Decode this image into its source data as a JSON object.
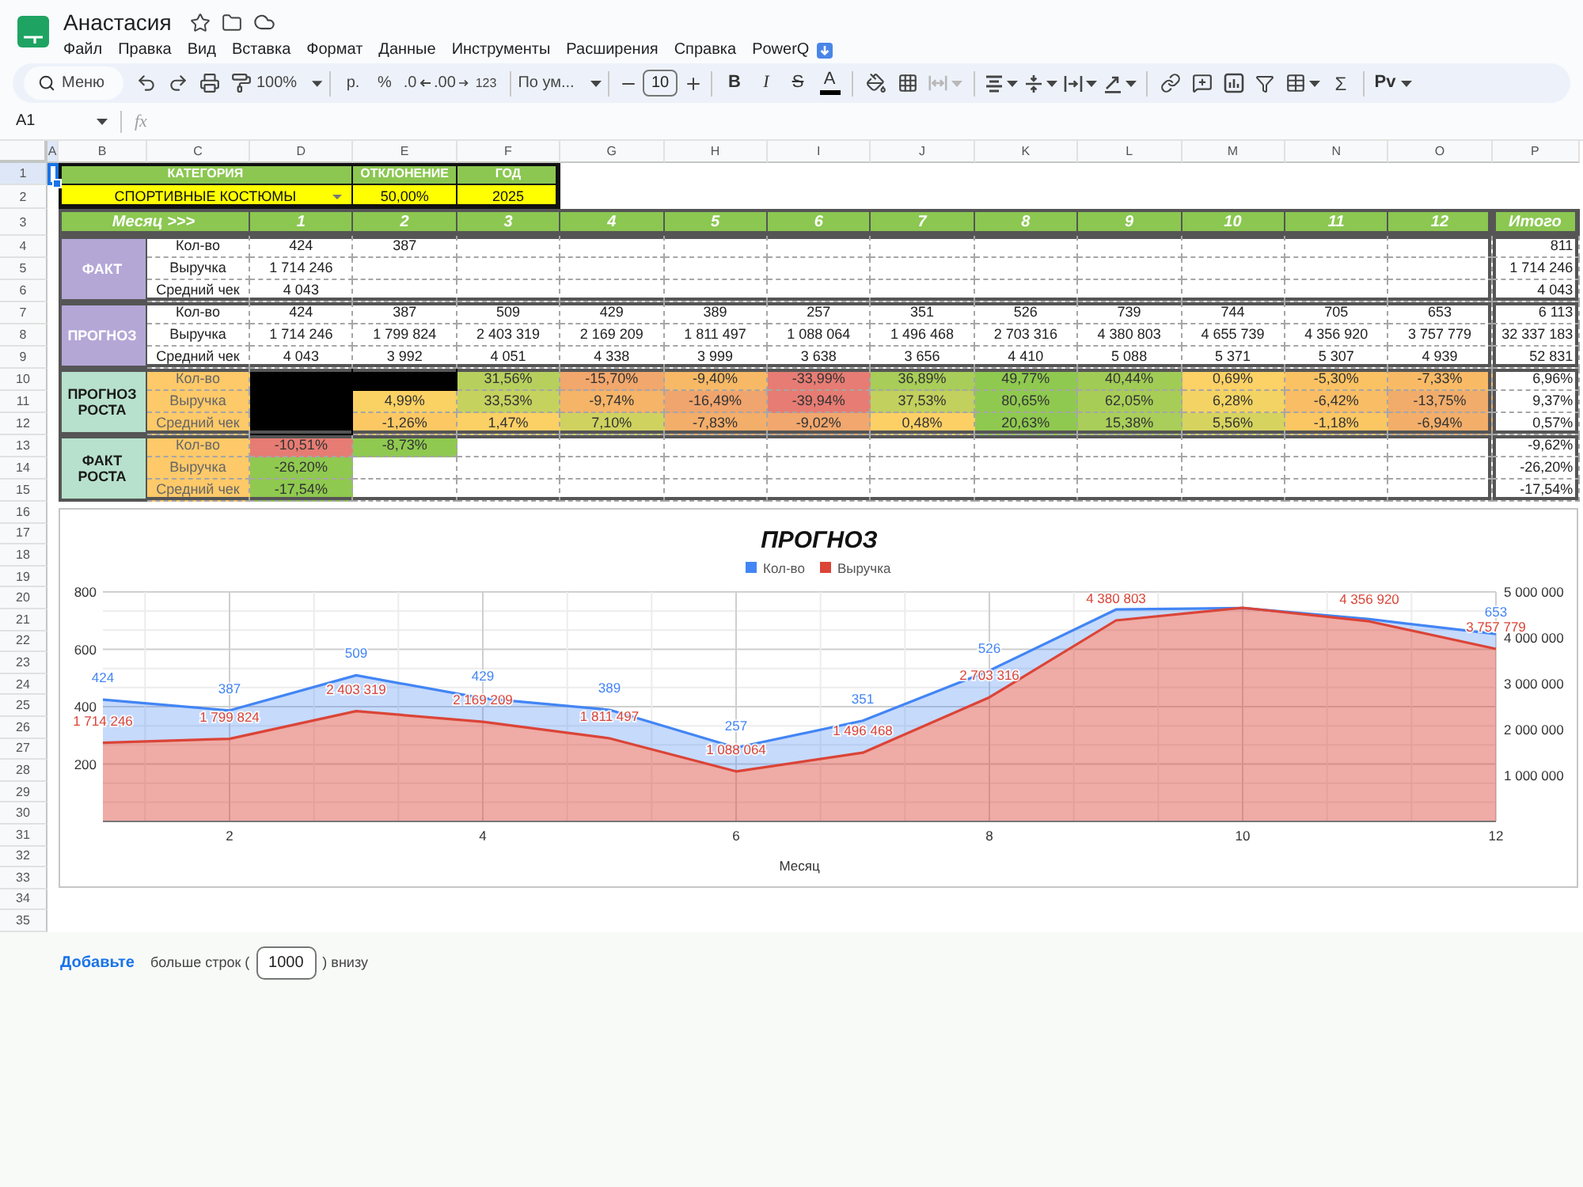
{
  "document": {
    "title": "Анастасия"
  },
  "menu": [
    "Файл",
    "Правка",
    "Вид",
    "Вставка",
    "Формат",
    "Данные",
    "Инструменты",
    "Расширения",
    "Справка",
    "PowerQ"
  ],
  "toolbar": {
    "search": {
      "placeholder": "Меню"
    },
    "zoom": "100%",
    "currency": "р.",
    "percent": "%",
    "decrease_decimals": ".0",
    "increase_decimals": ".00",
    "number_format": "123",
    "font": "По ум...",
    "font_size": "10",
    "bold": "B",
    "italic": "I",
    "strikethrough": "S",
    "text_color": "A",
    "functions": "Σ",
    "addon": "Pv"
  },
  "formula_bar": {
    "name_box": "A1",
    "fx": "fx"
  },
  "sheet": {
    "columns": [
      {
        "label": "A",
        "selected": true
      },
      {
        "label": "B",
        "selected": false
      },
      {
        "label": "C",
        "selected": false
      },
      {
        "label": "D",
        "selected": false
      },
      {
        "label": "E",
        "selected": false
      },
      {
        "label": "F",
        "selected": false
      },
      {
        "label": "G",
        "selected": false
      },
      {
        "label": "H",
        "selected": false
      },
      {
        "label": "I",
        "selected": false
      },
      {
        "label": "J",
        "selected": false
      },
      {
        "label": "K",
        "selected": false
      },
      {
        "label": "L",
        "selected": false
      },
      {
        "label": "M",
        "selected": false
      },
      {
        "label": "N",
        "selected": false
      },
      {
        "label": "O",
        "selected": false
      },
      {
        "label": "P",
        "selected": false
      }
    ],
    "rows": [
      {
        "label": "1",
        "selected": true
      },
      {
        "label": "2",
        "selected": false
      },
      {
        "label": "3",
        "selected": false
      },
      {
        "label": "4",
        "selected": false
      },
      {
        "label": "5",
        "selected": false
      },
      {
        "label": "6",
        "selected": false
      },
      {
        "label": "7",
        "selected": false
      },
      {
        "label": "8",
        "selected": false
      },
      {
        "label": "9",
        "selected": false
      },
      {
        "label": "10",
        "selected": false
      },
      {
        "label": "11",
        "selected": false
      },
      {
        "label": "12",
        "selected": false
      },
      {
        "label": "13",
        "selected": false
      },
      {
        "label": "14",
        "selected": false
      },
      {
        "label": "15",
        "selected": false
      },
      {
        "label": "16",
        "selected": false
      },
      {
        "label": "17",
        "selected": false
      },
      {
        "label": "18",
        "selected": false
      },
      {
        "label": "19",
        "selected": false
      },
      {
        "label": "20",
        "selected": false
      },
      {
        "label": "21",
        "selected": false
      },
      {
        "label": "22",
        "selected": false
      },
      {
        "label": "23",
        "selected": false
      },
      {
        "label": "24",
        "selected": false
      },
      {
        "label": "25",
        "selected": false
      },
      {
        "label": "26",
        "selected": false
      },
      {
        "label": "27",
        "selected": false
      },
      {
        "label": "28",
        "selected": false
      },
      {
        "label": "29",
        "selected": false
      },
      {
        "label": "30",
        "selected": false
      },
      {
        "label": "31",
        "selected": false
      },
      {
        "label": "32",
        "selected": false
      },
      {
        "label": "33",
        "selected": false
      },
      {
        "label": "34",
        "selected": false
      },
      {
        "label": "35",
        "selected": false
      }
    ],
    "params": {
      "category_label": "КАТЕГОРИЯ",
      "deviation_label": "ОТКЛОНЕНИЕ",
      "year_label": "ГОД",
      "category": "СПОРТИВНЫЕ КОСТЮМЫ",
      "deviation": "50,00%",
      "year": "2025"
    },
    "month_header": {
      "label": "Месяц >>>",
      "months": [
        "1",
        "2",
        "3",
        "4",
        "5",
        "6",
        "7",
        "8",
        "9",
        "10",
        "11",
        "12"
      ],
      "total": "Итого"
    },
    "sections": [
      {
        "kind": "values",
        "title": "ФАКТ",
        "rows": [
          {
            "label": "Кол-во",
            "cells": [
              "424",
              "387",
              null,
              null,
              null,
              null,
              null,
              null,
              null,
              null,
              null,
              null
            ],
            "total": "811"
          },
          {
            "label": "Выручка",
            "cells": [
              "1 714 246",
              null,
              null,
              null,
              null,
              null,
              null,
              null,
              null,
              null,
              null,
              null
            ],
            "total": "1 714 246"
          },
          {
            "label": "Средний чек",
            "cells": [
              "4 043",
              null,
              null,
              null,
              null,
              null,
              null,
              null,
              null,
              null,
              null,
              null
            ],
            "total": "4 043"
          }
        ]
      },
      {
        "kind": "values",
        "title": "ПРОГНОЗ",
        "rows": [
          {
            "label": "Кол-во",
            "cells": [
              "424",
              "387",
              "509",
              "429",
              "389",
              "257",
              "351",
              "526",
              "739",
              "744",
              "705",
              "653"
            ],
            "total": "6 113"
          },
          {
            "label": "Выручка",
            "cells": [
              "1 714 246",
              "1 799 824",
              "2 403 319",
              "2 169 209",
              "1 811 497",
              "1 088 064",
              "1 496 468",
              "2 703 316",
              "4 380 803",
              "4 655 739",
              "4 356 920",
              "3 757 779"
            ],
            "total": "32 337 183"
          },
          {
            "label": "Средний чек",
            "cells": [
              "4 043",
              "3 992",
              "4 051",
              "4 338",
              "3 999",
              "3 638",
              "3 656",
              "4 410",
              "5 088",
              "5 371",
              "5 307",
              "4 939"
            ],
            "total": "52 831"
          }
        ]
      },
      {
        "kind": "growth",
        "title": "ПРОГНОЗ РОСТА",
        "rows": [
          {
            "label": "Кол-во",
            "cells": [
              {
                "color": "#000000"
              },
              {
                "color": "#000000"
              },
              {
                "value": "31,56%",
                "color": "#b7d05d"
              },
              {
                "value": "-15,70%",
                "color": "#f2a76c"
              },
              {
                "value": "-9,40%",
                "color": "#f7b966"
              },
              {
                "value": "-33,99%",
                "color": "#e67c73"
              },
              {
                "value": "36,89%",
                "color": "#a8cd58"
              },
              {
                "value": "49,77%",
                "color": "#8fc950"
              },
              {
                "value": "40,44%",
                "color": "#a0cb55"
              },
              {
                "value": "0,69%",
                "color": "#fcd166"
              },
              {
                "value": "-5,30%",
                "color": "#fbc263"
              },
              {
                "value": "-7,33%",
                "color": "#f9ba66"
              }
            ],
            "total": "6,96%"
          },
          {
            "label": "Выручка",
            "cells": [
              {
                "color": "#000000"
              },
              {
                "value": "4,99%",
                "color": "#fad163"
              },
              {
                "value": "33,53%",
                "color": "#c6d25e"
              },
              {
                "value": "-9,74%",
                "color": "#f5b468"
              },
              {
                "value": "-16,49%",
                "color": "#f0a46e"
              },
              {
                "value": "-39,94%",
                "color": "#e67c73"
              },
              {
                "value": "37,53%",
                "color": "#c2d05d"
              },
              {
                "value": "80,65%",
                "color": "#8fc950"
              },
              {
                "value": "62,05%",
                "color": "#a7cd57"
              },
              {
                "value": "6,28%",
                "color": "#f2d363"
              },
              {
                "value": "-6,42%",
                "color": "#f8bd65"
              },
              {
                "value": "-13,75%",
                "color": "#f1ac6b"
              }
            ],
            "total": "9,37%"
          },
          {
            "label": "Средний чек",
            "cells": [
              {
                "color": "#000000"
              },
              {
                "value": "-1,26%",
                "color": "#fcc864"
              },
              {
                "value": "1,47%",
                "color": "#fbd065"
              },
              {
                "value": "7,10%",
                "color": "#cfd25f"
              },
              {
                "value": "-7,83%",
                "color": "#f3ae6a"
              },
              {
                "value": "-9,02%",
                "color": "#f1a76d"
              },
              {
                "value": "0,48%",
                "color": "#fdd066"
              },
              {
                "value": "20,63%",
                "color": "#8fc950"
              },
              {
                "value": "15,38%",
                "color": "#a9ce59"
              },
              {
                "value": "5,56%",
                "color": "#d6d35f"
              },
              {
                "value": "-1,18%",
                "color": "#fbc763"
              },
              {
                "value": "-6,94%",
                "color": "#f3ae69"
              }
            ],
            "total": "0,57%"
          }
        ]
      },
      {
        "kind": "growth",
        "title": "ФАКТ РОСТА",
        "rows": [
          {
            "label": "Кол-во",
            "cells": [
              {
                "value": "-10,51%",
                "color": "#e67c73"
              },
              {
                "value": "-8,73%",
                "color": "#8fc950"
              },
              null,
              null,
              null,
              null,
              null,
              null,
              null,
              null,
              null,
              null
            ],
            "total": "-9,62%"
          },
          {
            "label": "Выручка",
            "cells": [
              {
                "value": "-26,20%",
                "color": "#8fc950"
              },
              null,
              null,
              null,
              null,
              null,
              null,
              null,
              null,
              null,
              null,
              null
            ],
            "total": "-26,20%"
          },
          {
            "label": "Средний чек",
            "cells": [
              {
                "value": "-17,54%",
                "color": "#8fc950"
              },
              null,
              null,
              null,
              null,
              null,
              null,
              null,
              null,
              null,
              null,
              null
            ],
            "total": "-17,54%"
          }
        ]
      }
    ]
  },
  "chart": {
    "chart_data": {
      "type": "area",
      "title": "ПРОГНОЗ",
      "xlabel": "Месяц",
      "legend": "top",
      "grid": true,
      "x": [
        1,
        2,
        3,
        4,
        5,
        6,
        7,
        8,
        9,
        10,
        11,
        12
      ],
      "xlim": [
        1,
        12
      ],
      "xticks": [
        2,
        4,
        6,
        8,
        10,
        12
      ],
      "ylim": [
        0,
        800
      ],
      "yticks": [
        200,
        400,
        600,
        800
      ],
      "y2lim": [
        0,
        5000000
      ],
      "y2ticks": [
        {
          "value": 1000000,
          "label": "1 000 000"
        },
        {
          "value": 2000000,
          "label": "2 000 000"
        },
        {
          "value": 3000000,
          "label": "3 000 000"
        },
        {
          "value": 4000000,
          "label": "4 000 000"
        },
        {
          "value": 5000000,
          "label": "5 000 000"
        }
      ],
      "series": [
        {
          "name": "Кол-во",
          "color": "#4285f4",
          "values": [
            424,
            387,
            509,
            429,
            389,
            257,
            351,
            526,
            739,
            744,
            705,
            653
          ],
          "value_labels": [
            "424",
            "387",
            "509",
            "429",
            "389",
            "257",
            "351",
            "526",
            null,
            null,
            null,
            "653"
          ]
        },
        {
          "name": "Выручка",
          "axis": "y2",
          "color": "#db4437",
          "values": [
            1714246,
            1799824,
            2403319,
            2169209,
            1811497,
            1088064,
            1496468,
            2703316,
            4380803,
            4655739,
            4356920,
            3757779
          ],
          "value_labels": [
            "1 714 246",
            "1 799 824",
            "2 403 319",
            "2 169 209",
            "1 811 497",
            "1 088 064",
            "1 496 468",
            "2 703 316",
            "4 380 803",
            null,
            "4 356 920",
            "3 757 779"
          ]
        }
      ]
    }
  },
  "footer": {
    "link": "Добавьте",
    "text_before": "больше строк (",
    "rows_value": "1000",
    "text_after": ") внизу"
  }
}
